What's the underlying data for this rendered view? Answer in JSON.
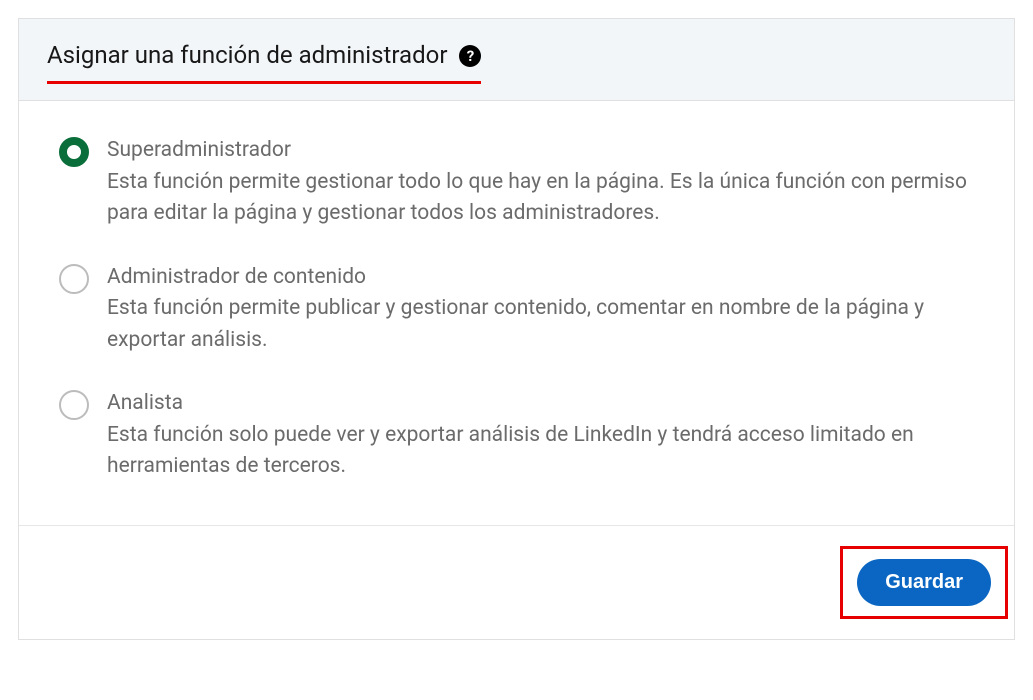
{
  "header": {
    "title": "Asignar una función de administrador",
    "help_icon": "?"
  },
  "roles": {
    "items": [
      {
        "title": "Superadministrador",
        "description": "Esta función permite gestionar todo lo que hay en la página. Es la única función con permiso para editar la página y gestionar todos los administradores.",
        "selected": true
      },
      {
        "title": "Administrador de contenido",
        "description": "Esta función permite publicar y gestionar contenido, comentar en nombre de la página y exportar análisis.",
        "selected": false
      },
      {
        "title": "Analista",
        "description": "Esta función solo puede ver y exportar análisis de LinkedIn y tendrá acceso limitado en herramientas de terceros.",
        "selected": false
      }
    ]
  },
  "footer": {
    "save_label": "Guardar"
  }
}
